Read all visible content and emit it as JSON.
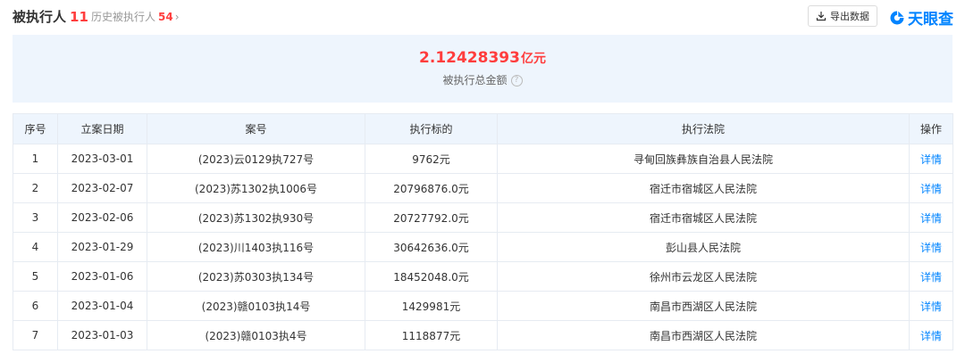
{
  "header": {
    "title": "被执行人",
    "title_count": "11",
    "history_label": "历史被执行人",
    "history_count": "54",
    "history_chevron": "›",
    "export_label": "导出数据",
    "export_icon": "download-icon",
    "brand_name": "天眼查",
    "brand_icon": "tianyancha-logo-icon"
  },
  "summary": {
    "amount": "2.12428393",
    "unit": "亿元",
    "label": "被执行总金额",
    "help_icon": "question-circle-icon",
    "help_glyph": "?"
  },
  "table": {
    "headers": [
      "序号",
      "立案日期",
      "案号",
      "执行标的",
      "执行法院",
      "操作"
    ],
    "rows": [
      {
        "no": "1",
        "date": "2023-03-01",
        "case": "(2023)云0129执727号",
        "amount": "9762元",
        "court": "寻甸回族彝族自治县人民法院",
        "action": "详情"
      },
      {
        "no": "2",
        "date": "2023-02-07",
        "case": "(2023)苏1302执1006号",
        "amount": "20796876.0元",
        "court": "宿迁市宿城区人民法院",
        "action": "详情"
      },
      {
        "no": "3",
        "date": "2023-02-06",
        "case": "(2023)苏1302执930号",
        "amount": "20727792.0元",
        "court": "宿迁市宿城区人民法院",
        "action": "详情"
      },
      {
        "no": "4",
        "date": "2023-01-29",
        "case": "(2023)川1403执116号",
        "amount": "30642636.0元",
        "court": "彭山县人民法院",
        "action": "详情"
      },
      {
        "no": "5",
        "date": "2023-01-06",
        "case": "(2023)苏0303执134号",
        "amount": "18452048.0元",
        "court": "徐州市云龙区人民法院",
        "action": "详情"
      },
      {
        "no": "6",
        "date": "2023-01-04",
        "case": "(2023)赣0103执14号",
        "amount": "1429981元",
        "court": "南昌市西湖区人民法院",
        "action": "详情"
      },
      {
        "no": "7",
        "date": "2023-01-03",
        "case": "(2023)赣0103执4号",
        "amount": "1118877元",
        "court": "南昌市西湖区人民法院",
        "action": "详情"
      }
    ]
  },
  "colors": {
    "accent_red": "#ff3d3d",
    "link_blue": "#0084ff",
    "header_bg": "#eef5fd",
    "border": "#e6ebf2"
  }
}
